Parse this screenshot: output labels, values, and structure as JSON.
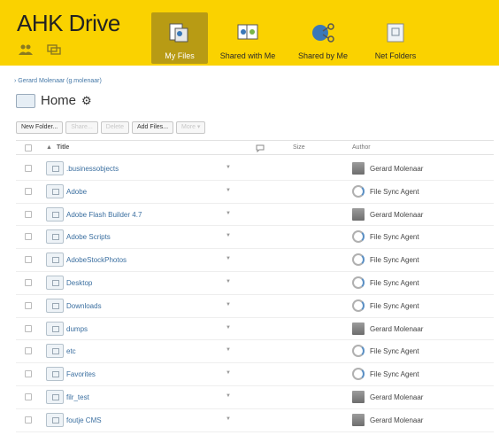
{
  "app": {
    "title": "AHK Drive"
  },
  "header_icons": [
    {
      "icon": "users-icon"
    },
    {
      "icon": "chat-icon"
    }
  ],
  "nav": [
    {
      "label": "My Files",
      "icon": "my-files-icon",
      "active": true
    },
    {
      "label": "Shared with Me",
      "icon": "shared-with-me-icon",
      "active": false
    },
    {
      "label": "Shared by Me",
      "icon": "shared-by-me-icon",
      "active": false
    },
    {
      "label": "Net Folders",
      "icon": "net-folders-icon",
      "active": false
    }
  ],
  "breadcrumb": "Gerard Molenaar (g.molenaar)",
  "page": {
    "title": "Home"
  },
  "toolbar": {
    "new_folder": "New Folder...",
    "share": "Share...",
    "delete": "Delete",
    "add_files": "Add Files...",
    "more": "More ▾"
  },
  "table": {
    "headers": {
      "title": "Title",
      "size": "Size",
      "author": "Author"
    },
    "rows": [
      {
        "name": ".businessobjects",
        "author": "Gerard Molenaar",
        "author_icon": "user-avatar"
      },
      {
        "name": "Adobe",
        "author": "File Sync Agent",
        "author_icon": "sync-agent-icon"
      },
      {
        "name": "Adobe Flash Builder 4.7",
        "author": "Gerard Molenaar",
        "author_icon": "user-avatar"
      },
      {
        "name": "Adobe Scripts",
        "author": "File Sync Agent",
        "author_icon": "sync-agent-icon"
      },
      {
        "name": "AdobeStockPhotos",
        "author": "File Sync Agent",
        "author_icon": "sync-agent-icon"
      },
      {
        "name": "Desktop",
        "author": "File Sync Agent",
        "author_icon": "sync-agent-icon"
      },
      {
        "name": "Downloads",
        "author": "File Sync Agent",
        "author_icon": "sync-agent-icon"
      },
      {
        "name": "dumps",
        "author": "Gerard Molenaar",
        "author_icon": "user-avatar"
      },
      {
        "name": "etc",
        "author": "File Sync Agent",
        "author_icon": "sync-agent-icon"
      },
      {
        "name": "Favorites",
        "author": "File Sync Agent",
        "author_icon": "sync-agent-icon"
      },
      {
        "name": "filr_test",
        "author": "Gerard Molenaar",
        "author_icon": "user-avatar"
      },
      {
        "name": "foutje CMS",
        "author": "Gerard Molenaar",
        "author_icon": "user-avatar"
      }
    ]
  },
  "colors": {
    "header_bg": "#fad200",
    "active_tab": "#b89b14",
    "link": "#3b6fa0"
  }
}
